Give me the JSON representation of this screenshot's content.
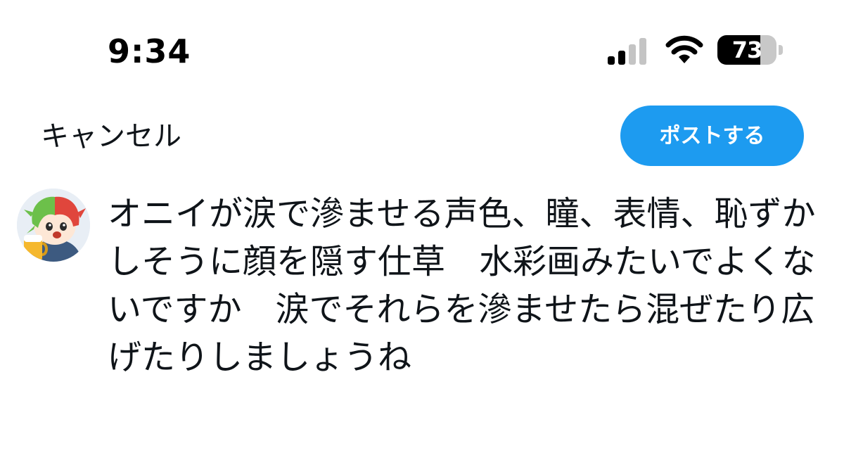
{
  "status_bar": {
    "time": "9:34",
    "battery_level": "73",
    "battery_fraction": 0.73,
    "signal_bars_active": 2,
    "signal_bars_total": 4,
    "signal_icon": "cellular-signal-icon",
    "wifi_icon": "wifi-icon",
    "battery_icon": "battery-icon"
  },
  "compose": {
    "cancel_label": "キャンセル",
    "post_label": "ポストする",
    "post_color": "#1d9bf0",
    "text": "オニイが涙で滲ませる声色、瞳、表情、恥ずかしそうに顔を隠す仕草　水彩画みたいでよくないですか　涙でそれらを滲ませたら混ぜたり広げたりしましょうね"
  }
}
